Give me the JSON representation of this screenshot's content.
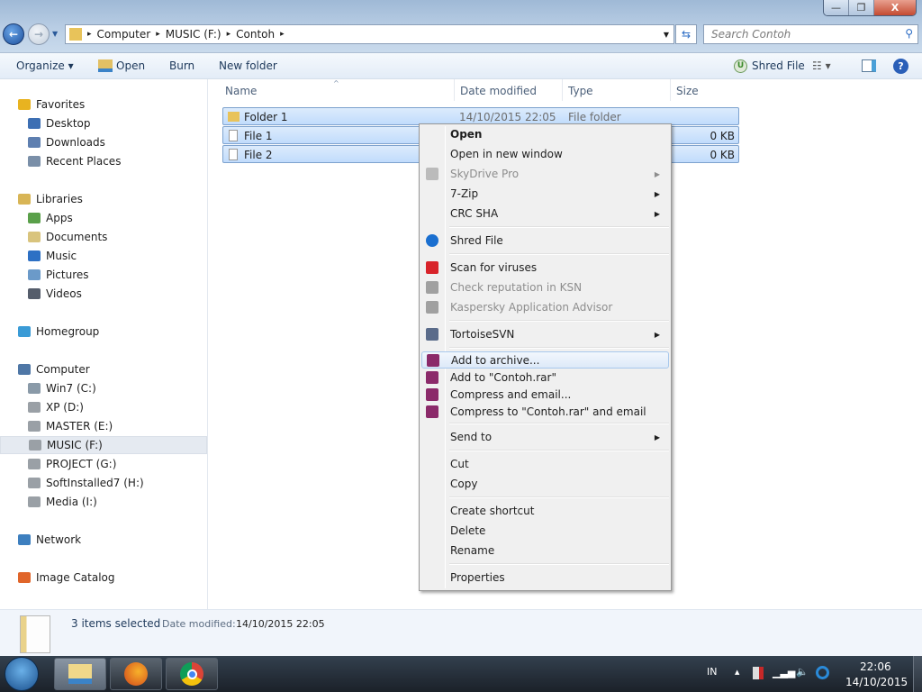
{
  "window": {
    "minimize": "—",
    "restore": "❐",
    "close": "X"
  },
  "address": {
    "crumbs": [
      "Computer",
      "MUSIC (F:)",
      "Contoh"
    ],
    "separator": "▸"
  },
  "search": {
    "placeholder": "Search Contoh"
  },
  "toolbar": {
    "organize": "Organize ▾",
    "open": "Open",
    "burn": "Burn",
    "new_folder": "New folder",
    "shred_file": "Shred File",
    "view": "☷ ▾"
  },
  "nav": {
    "items": [
      {
        "label": "Favorites",
        "icon": "star-icon",
        "color": "#e8b320",
        "indent": 0
      },
      {
        "label": "Desktop",
        "icon": "desktop-icon",
        "color": "#3d6fb3",
        "indent": 1
      },
      {
        "label": "Downloads",
        "icon": "downloads-icon",
        "color": "#5e7fb0",
        "indent": 1
      },
      {
        "label": "Recent Places",
        "icon": "recent-places-icon",
        "color": "#7a8fa8",
        "indent": 1
      },
      {
        "label": "Libraries",
        "icon": "libraries-icon",
        "color": "#d8b556",
        "indent": 0
      },
      {
        "label": "Apps",
        "icon": "apps-icon",
        "color": "#5aa04a",
        "indent": 1
      },
      {
        "label": "Documents",
        "icon": "documents-icon",
        "color": "#d9c47d",
        "indent": 1
      },
      {
        "label": "Music",
        "icon": "music-icon",
        "color": "#2d70c4",
        "indent": 1
      },
      {
        "label": "Pictures",
        "icon": "pictures-icon",
        "color": "#6b9ac9",
        "indent": 1
      },
      {
        "label": "Videos",
        "icon": "videos-icon",
        "color": "#555d6b",
        "indent": 1
      },
      {
        "label": "Homegroup",
        "icon": "homegroup-icon",
        "color": "#3a9bd6",
        "indent": 0
      },
      {
        "label": "Computer",
        "icon": "computer-icon",
        "color": "#4f77a6",
        "indent": 0
      },
      {
        "label": "Win7 (C:)",
        "icon": "drive-icon",
        "color": "#8a9aa8",
        "indent": 1
      },
      {
        "label": "XP (D:)",
        "icon": "drive-icon",
        "color": "#9aa0a6",
        "indent": 1
      },
      {
        "label": "MASTER (E:)",
        "icon": "drive-icon",
        "color": "#9aa0a6",
        "indent": 1
      },
      {
        "label": "MUSIC (F:)",
        "icon": "drive-icon",
        "color": "#9aa0a6",
        "indent": 1,
        "selected": true
      },
      {
        "label": "PROJECT (G:)",
        "icon": "drive-icon",
        "color": "#9aa0a6",
        "indent": 1
      },
      {
        "label": "SoftInstalled7 (H:)",
        "icon": "drive-icon",
        "color": "#9aa0a6",
        "indent": 1
      },
      {
        "label": "Media (I:)",
        "icon": "drive-icon",
        "color": "#9aa0a6",
        "indent": 1
      },
      {
        "label": "Network",
        "icon": "network-icon",
        "color": "#3d7fbf",
        "indent": 0
      },
      {
        "label": "Image Catalog",
        "icon": "image-catalog-icon",
        "color": "#e0652a",
        "indent": 0
      }
    ]
  },
  "columns": {
    "name": "Name",
    "date": "Date modified",
    "type": "Type",
    "size": "Size"
  },
  "files": [
    {
      "name": "Folder 1",
      "date": "14/10/2015 22:05",
      "type": "File folder",
      "size": ""
    },
    {
      "name": "File 1",
      "date": "",
      "type": "",
      "size": "0 KB"
    },
    {
      "name": "File 2",
      "date": "",
      "type": "",
      "size": "0 KB"
    }
  ],
  "context_menu": {
    "items": [
      {
        "label": "Open",
        "bold": true
      },
      {
        "label": "Open in new window"
      },
      {
        "label": "SkyDrive Pro",
        "disabled": true,
        "submenu": true,
        "icon": "cloud-icon"
      },
      {
        "label": "7-Zip",
        "submenu": true
      },
      {
        "label": "CRC SHA",
        "submenu": true
      },
      {
        "sep": true
      },
      {
        "label": "Shred File",
        "icon": "shred-icon",
        "color": "#1a6fd0"
      },
      {
        "sep": true
      },
      {
        "label": "Scan for viruses",
        "icon": "kaspersky-icon",
        "color": "#d8232a"
      },
      {
        "label": "Check reputation in KSN",
        "disabled": true,
        "icon": "kaspersky-icon",
        "color": "#a0a0a0"
      },
      {
        "label": "Kaspersky Application Advisor",
        "disabled": true,
        "icon": "kaspersky-icon",
        "color": "#a0a0a0"
      },
      {
        "sep": true
      },
      {
        "label": "TortoiseSVN",
        "submenu": true,
        "icon": "tortoisesvn-icon",
        "color": "#5a6b8a"
      },
      {
        "sep": true
      },
      {
        "label": "Add to archive...",
        "icon": "winrar-icon",
        "color": "#8b2a6a",
        "short": true,
        "highlighted": true
      },
      {
        "label": "Add to \"Contoh.rar\"",
        "icon": "winrar-icon",
        "color": "#8b2a6a",
        "short": true
      },
      {
        "label": "Compress and email...",
        "icon": "winrar-icon",
        "color": "#8b2a6a",
        "short": true
      },
      {
        "label": "Compress to \"Contoh.rar\" and email",
        "icon": "winrar-icon",
        "color": "#8b2a6a",
        "short": true
      },
      {
        "sep": true
      },
      {
        "label": "Send to",
        "submenu": true
      },
      {
        "sep": true
      },
      {
        "label": "Cut"
      },
      {
        "label": "Copy"
      },
      {
        "sep": true
      },
      {
        "label": "Create shortcut"
      },
      {
        "label": "Delete"
      },
      {
        "label": "Rename"
      },
      {
        "sep": true
      },
      {
        "label": "Properties"
      }
    ]
  },
  "details": {
    "count": "3 items selected",
    "date_label": "Date modified:",
    "date_value": "14/10/2015 22:05"
  },
  "taskbar": {
    "apps": [
      "explorer-icon",
      "firefox-icon",
      "chrome-icon"
    ],
    "lang": "IN",
    "time": "22:06",
    "date": "14/10/2015",
    "tray_arrow": "▲"
  }
}
